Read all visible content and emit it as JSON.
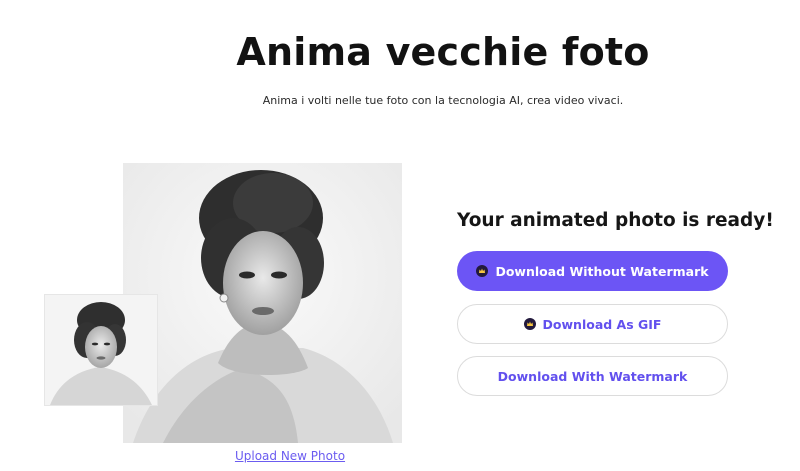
{
  "header": {
    "title": "Anima vecchie foto",
    "subtitle": "Anima i volti nelle tue foto con la tecnologia AI, crea video vivaci."
  },
  "photos": {
    "upload_label": "Upload New Photo"
  },
  "result": {
    "title": "Your animated photo is ready!",
    "buttons": {
      "download_no_watermark": "Download Without Watermark",
      "download_gif": "Download As GIF",
      "download_with_watermark": "Download With Watermark"
    },
    "premium_icon": "crown-badge-icon"
  },
  "colors": {
    "accent": "#6c55f5",
    "link": "#6b5cf0",
    "badge": "#231a3d",
    "badge_crown": "#f5c542"
  }
}
